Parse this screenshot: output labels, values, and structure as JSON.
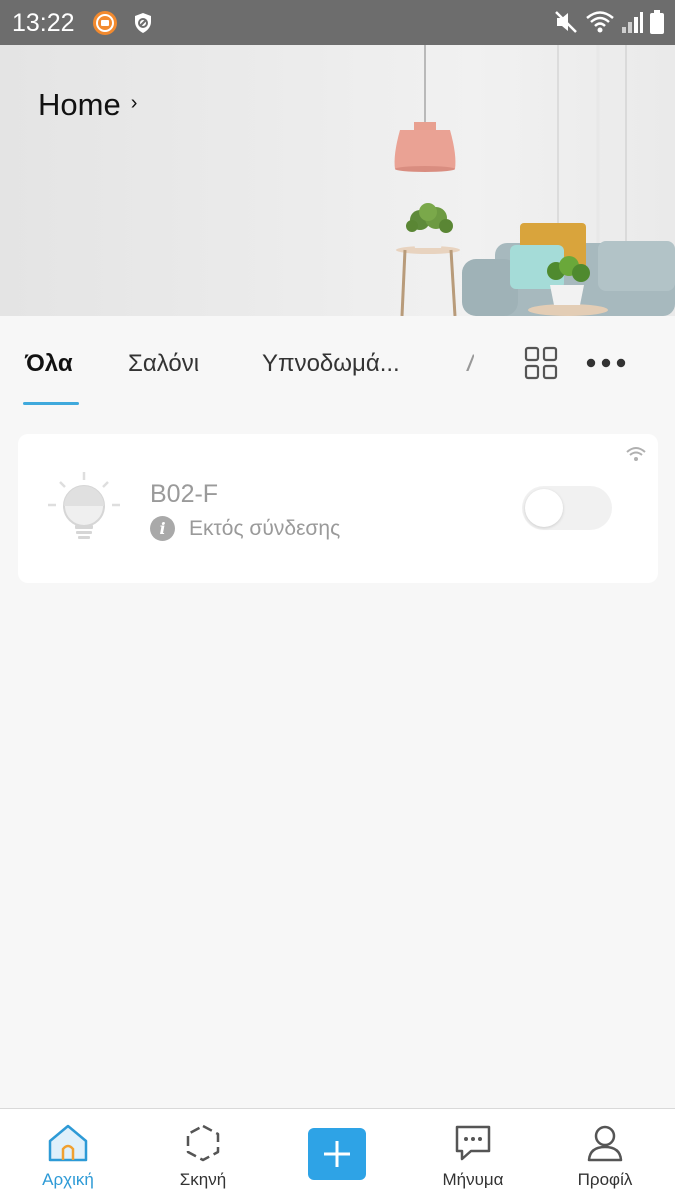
{
  "status_bar": {
    "time": "13:22"
  },
  "header": {
    "title": "Home",
    "chevron": "›"
  },
  "tabs": [
    {
      "label": "Όλα",
      "active": true
    },
    {
      "label": "Σαλόνι",
      "active": false
    },
    {
      "label": "Υπνοδωμά...",
      "active": false
    },
    {
      "label": "Λ",
      "active": false
    }
  ],
  "tab_actions": {
    "grid_icon": "grid-view-icon",
    "more_icon": "more-dots-icon"
  },
  "device": {
    "name": "B02-F",
    "status": "Εκτός σύνδεσης",
    "power_on": false,
    "icon": "light-bulb-icon"
  },
  "bottom_nav": [
    {
      "label": "Αρχική",
      "icon": "home-icon",
      "active": true
    },
    {
      "label": "Σκηνή",
      "icon": "scene-icon",
      "active": false
    },
    {
      "label": "",
      "icon": "plus-icon",
      "active": false
    },
    {
      "label": "Μήνυμα",
      "icon": "message-icon",
      "active": false
    },
    {
      "label": "Προφίλ",
      "icon": "profile-icon",
      "active": false
    }
  ],
  "colors": {
    "accent": "#2ea3e6",
    "status_bar": "#6d6d6d",
    "background": "#f7f7f7",
    "tab_underline": "#3fa9dc"
  }
}
